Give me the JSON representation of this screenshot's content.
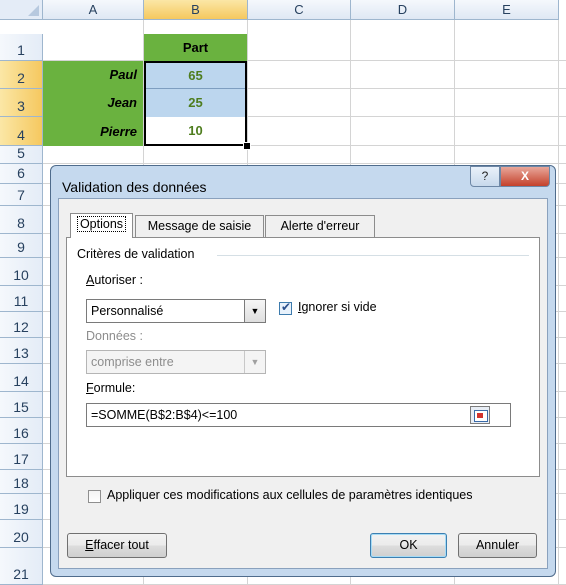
{
  "sheet": {
    "columns": [
      "A",
      "B",
      "C",
      "D",
      "E"
    ],
    "selected_column": "B",
    "rows": [
      "1",
      "2",
      "3",
      "4",
      "5",
      "6",
      "7",
      "8",
      "9",
      "10",
      "11",
      "12",
      "13",
      "14",
      "15",
      "16",
      "17",
      "18",
      "19",
      "20",
      "21"
    ],
    "selected_rows": [
      "2",
      "3",
      "4"
    ],
    "b1_header": "Part",
    "names": [
      "Paul",
      "Jean",
      "Pierre"
    ],
    "values": [
      65,
      25,
      10
    ],
    "colors": {
      "name_fill": "#6ab23f",
      "selection_fill": "#bcd6ee",
      "value_text": "#4e7d1e"
    }
  },
  "dialog": {
    "title": "Validation des données",
    "help_label": "?",
    "close_label": "X",
    "tabs": [
      "Options",
      "Message de saisie",
      "Alerte d'erreur"
    ],
    "active_tab": "Options",
    "group_label": "Critères de validation",
    "autoriser_label": "Autoriser :",
    "autoriser_value": "Personnalisé",
    "ignore_blank_label": "Ignorer si vide",
    "ignore_blank_checked": true,
    "donnees_label": "Données :",
    "donnees_value": "comprise entre",
    "formule_label": "Formule:",
    "formule_value": "=SOMME(B$2:B$4)<=100",
    "apply_label": "Appliquer ces modifications aux cellules de paramètres identiques",
    "apply_checked": false,
    "clear_button": "Effacer tout",
    "ok_button": "OK",
    "cancel_button": "Annuler"
  }
}
